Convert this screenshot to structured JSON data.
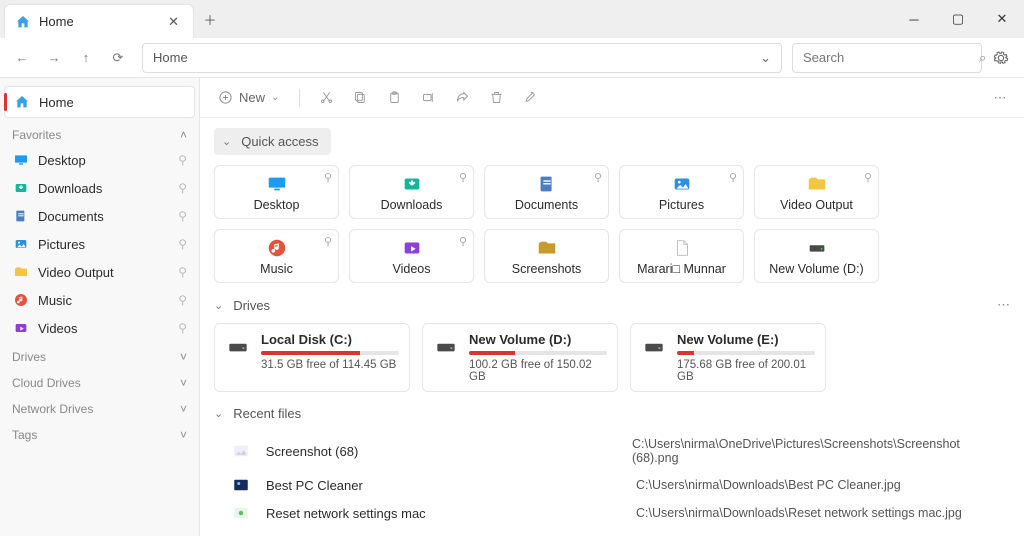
{
  "window": {
    "tab_title": "Home"
  },
  "address": "Home",
  "search_placeholder": "Search",
  "toolbar": {
    "new_label": "New"
  },
  "sidebar": {
    "home": "Home",
    "favorites_label": "Favorites",
    "favorites": [
      {
        "label": "Desktop",
        "icon": "desktop"
      },
      {
        "label": "Downloads",
        "icon": "downloads"
      },
      {
        "label": "Documents",
        "icon": "documents"
      },
      {
        "label": "Pictures",
        "icon": "pictures"
      },
      {
        "label": "Video Output",
        "icon": "folder-yellow"
      },
      {
        "label": "Music",
        "icon": "music"
      },
      {
        "label": "Videos",
        "icon": "videos"
      }
    ],
    "sections": [
      "Drives",
      "Cloud Drives",
      "Network Drives",
      "Tags"
    ]
  },
  "quick_access": {
    "title": "Quick access",
    "items": [
      {
        "label": "Desktop",
        "icon": "desktop",
        "pinned": true
      },
      {
        "label": "Downloads",
        "icon": "downloads",
        "pinned": true
      },
      {
        "label": "Documents",
        "icon": "documents",
        "pinned": true
      },
      {
        "label": "Pictures",
        "icon": "pictures",
        "pinned": true
      },
      {
        "label": "Video Output",
        "icon": "folder-yellow",
        "pinned": true
      },
      {
        "label": "Music",
        "icon": "music",
        "pinned": true
      },
      {
        "label": "Videos",
        "icon": "videos",
        "pinned": true
      },
      {
        "label": "Screenshots",
        "icon": "folder-dark",
        "pinned": false
      },
      {
        "label": "Marari□ Munnar",
        "icon": "file",
        "pinned": false
      },
      {
        "label": "New Volume (D:)",
        "icon": "drive",
        "pinned": false
      }
    ]
  },
  "drives": {
    "title": "Drives",
    "items": [
      {
        "name": "Local Disk (C:)",
        "free": "31.5 GB free of 114.45 GB",
        "fill": 72
      },
      {
        "name": "New Volume (D:)",
        "free": "100.2 GB free of 150.02 GB",
        "fill": 33
      },
      {
        "name": "New Volume (E:)",
        "free": "175.68 GB free of 200.01 GB",
        "fill": 12
      }
    ]
  },
  "recent": {
    "title": "Recent files",
    "items": [
      {
        "name": "Screenshot (68)",
        "path": "C:\\Users\\nirma\\OneDrive\\Pictures\\Screenshots\\Screenshot (68).png",
        "icon": "image-light"
      },
      {
        "name": "Best PC Cleaner",
        "path": "C:\\Users\\nirma\\Downloads\\Best PC Cleaner.jpg",
        "icon": "image-dark"
      },
      {
        "name": "Reset network settings mac",
        "path": "C:\\Users\\nirma\\Downloads\\Reset network settings mac.jpg",
        "icon": "image-green"
      }
    ]
  }
}
